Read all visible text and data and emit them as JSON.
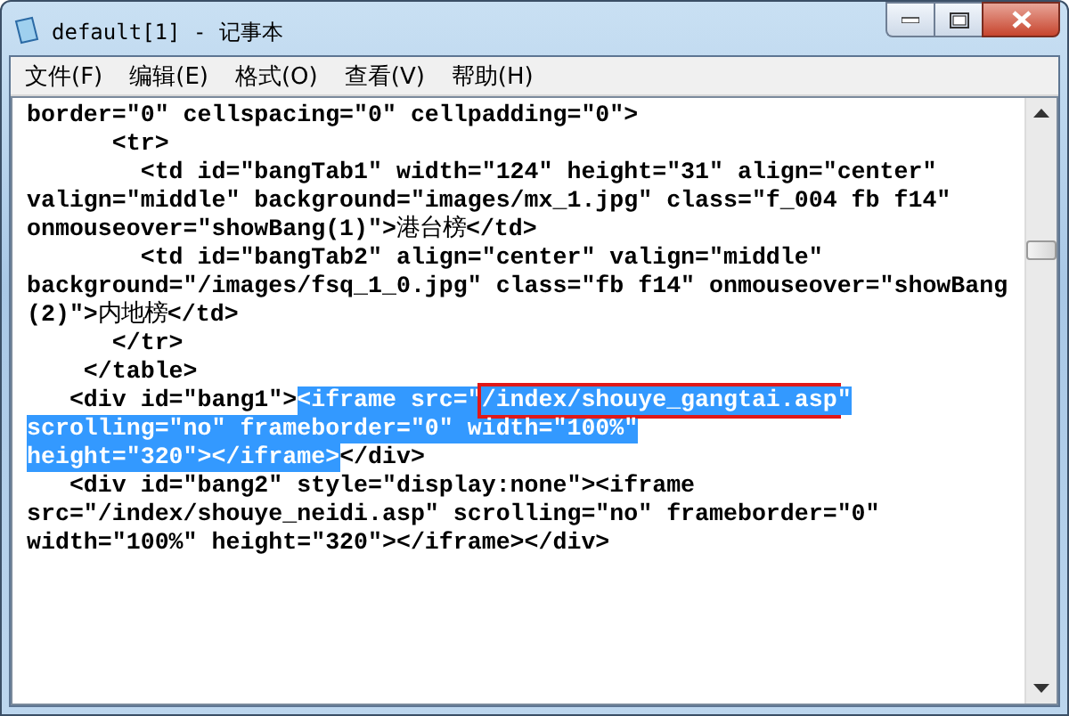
{
  "window": {
    "title": "default[1] - 记事本"
  },
  "menu": [
    {
      "label": "文件(F)"
    },
    {
      "label": "编辑(E)"
    },
    {
      "label": "格式(O)"
    },
    {
      "label": "查看(V)"
    },
    {
      "label": "帮助(H)"
    }
  ],
  "editor": {
    "lines": [
      {
        "segments": [
          {
            "text": "border=\"0\" cellspacing=\"0\" cellpadding=\"0\">",
            "selected": false,
            "marked": false
          }
        ]
      },
      {
        "segments": [
          {
            "text": "      <tr>",
            "selected": false,
            "marked": false
          }
        ]
      },
      {
        "segments": [
          {
            "text": "        <td id=\"bangTab1\" width=\"124\" height=\"31\" align=\"center\"",
            "selected": false,
            "marked": false
          }
        ]
      },
      {
        "segments": [
          {
            "text": "valign=\"middle\" background=\"images/mx_1.jpg\" class=\"f_004 fb f14\"",
            "selected": false,
            "marked": false
          }
        ]
      },
      {
        "segments": [
          {
            "text": "onmouseover=\"showBang(1)\">港台榜</td>",
            "selected": false,
            "marked": false
          }
        ]
      },
      {
        "segments": [
          {
            "text": "        <td id=\"bangTab2\" align=\"center\" valign=\"middle\"",
            "selected": false,
            "marked": false
          }
        ]
      },
      {
        "segments": [
          {
            "text": "background=\"/images/fsq_1_0.jpg\" class=\"fb f14\" onmouseover=\"showBang",
            "selected": false,
            "marked": false
          }
        ]
      },
      {
        "segments": [
          {
            "text": "(2)\">内地榜</td>",
            "selected": false,
            "marked": false
          }
        ]
      },
      {
        "segments": [
          {
            "text": "      </tr>",
            "selected": false,
            "marked": false
          }
        ]
      },
      {
        "segments": [
          {
            "text": "    </table>",
            "selected": false,
            "marked": false
          }
        ]
      },
      {
        "segments": [
          {
            "text": "   <div id=\"bang1\">",
            "selected": false,
            "marked": false
          },
          {
            "text": "<iframe src=\"",
            "selected": true,
            "marked": false
          },
          {
            "text": "/index/shouye_gangtai.asp",
            "selected": true,
            "marked": true
          },
          {
            "text": "\"",
            "selected": true,
            "marked": false
          }
        ]
      },
      {
        "segments": [
          {
            "text": "scrolling=\"no\" frameborder=\"0\" width=\"100%\"",
            "selected": true,
            "marked": false
          }
        ]
      },
      {
        "segments": [
          {
            "text": "height=\"320\"></iframe>",
            "selected": true,
            "marked": false
          },
          {
            "text": "</div>",
            "selected": false,
            "marked": false
          }
        ]
      },
      {
        "segments": [
          {
            "text": "   <div id=\"bang2\" style=\"display:none\"><iframe",
            "selected": false,
            "marked": false
          }
        ]
      },
      {
        "segments": [
          {
            "text": "src=\"/index/shouye_neidi.asp\" scrolling=\"no\" frameborder=\"0\"",
            "selected": false,
            "marked": false
          }
        ]
      },
      {
        "segments": [
          {
            "text": "width=\"100%\" height=\"320\"></iframe></div>",
            "selected": false,
            "marked": false
          }
        ]
      }
    ]
  }
}
